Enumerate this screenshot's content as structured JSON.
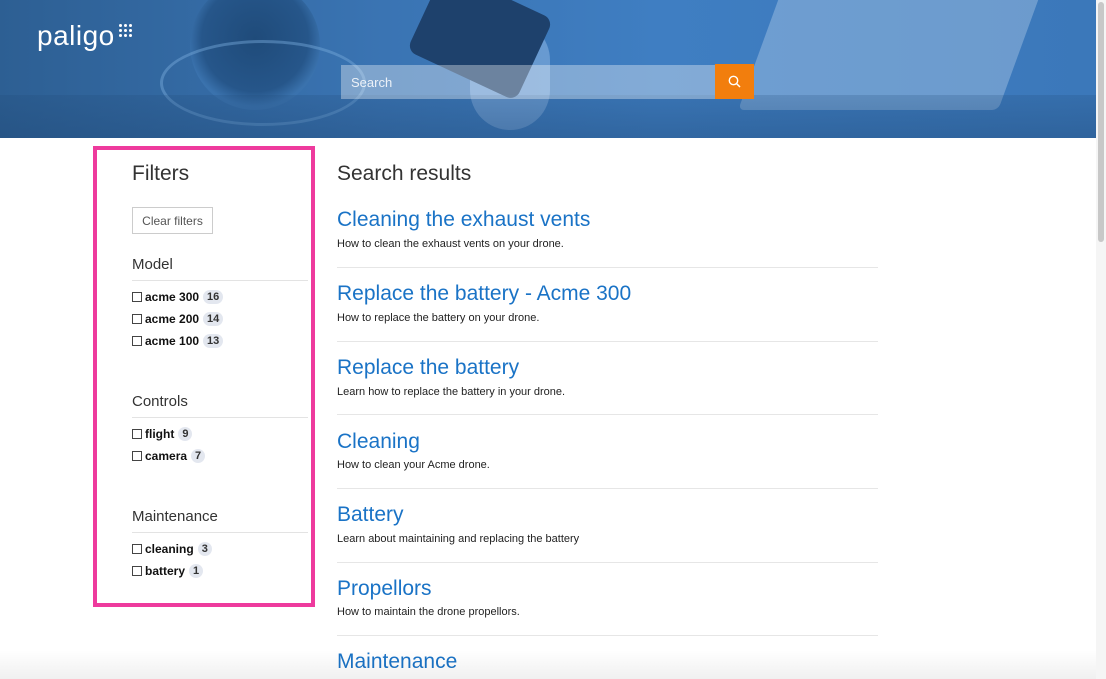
{
  "header": {
    "logo_text": "paligo",
    "search_placeholder": "Search"
  },
  "filters": {
    "title": "Filters",
    "clear_label": "Clear filters",
    "facets": [
      {
        "label": "Model",
        "items": [
          {
            "label": "acme 300",
            "count": "16"
          },
          {
            "label": "acme 200",
            "count": "14"
          },
          {
            "label": "acme 100",
            "count": "13"
          }
        ]
      },
      {
        "label": "Controls",
        "items": [
          {
            "label": "flight",
            "count": "9"
          },
          {
            "label": "camera",
            "count": "7"
          }
        ]
      },
      {
        "label": "Maintenance",
        "items": [
          {
            "label": "cleaning",
            "count": "3"
          },
          {
            "label": "battery",
            "count": "1"
          }
        ]
      }
    ]
  },
  "results": {
    "title": "Search results",
    "items": [
      {
        "title": "Cleaning the exhaust vents",
        "desc": "How to clean the exhaust vents on your drone."
      },
      {
        "title": "Replace the battery - Acme 300",
        "desc": "How to replace the battery on your drone."
      },
      {
        "title": "Replace the battery",
        "desc": "Learn how to replace the battery in your drone."
      },
      {
        "title": "Cleaning",
        "desc": "How to clean your Acme drone."
      },
      {
        "title": "Battery",
        "desc": "Learn about maintaining and replacing the battery"
      },
      {
        "title": "Propellors",
        "desc": "How to maintain the drone propellors."
      },
      {
        "title": "Maintenance",
        "desc": ""
      }
    ]
  },
  "colors": {
    "accent_orange": "#f27e0d",
    "link_blue": "#1a73c6",
    "highlight_pink": "#ee3a9d",
    "header_blue": "#3a74b3"
  },
  "icons": {
    "search": "search-icon",
    "logo_dots": "grid-dots-icon"
  }
}
